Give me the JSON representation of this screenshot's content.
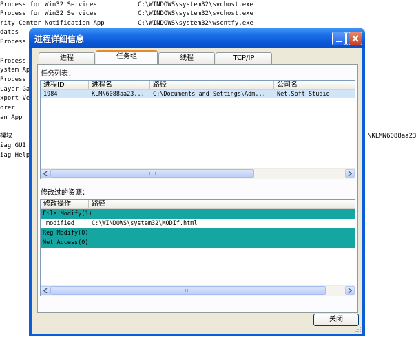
{
  "background": {
    "lines": [
      {
        "text": " Process for Win32 Services",
        "path": "C:\\WINDOWS\\system32\\svchost.exe"
      },
      {
        "text": " Process for Win32 Services",
        "path": "C:\\WINDOWS\\system32\\svchost.exe"
      },
      {
        "text": "rity Center Notification App",
        "path": "C:\\WINDOWS\\system32\\wscntfy.exe"
      },
      {
        "text": "dates",
        "path": ""
      },
      {
        "text": " Process",
        "path": ""
      },
      {
        "text": "",
        "path": ""
      },
      {
        "text": " Process",
        "path": ""
      },
      {
        "text": "ystem Ap",
        "path": ""
      },
      {
        "text": " Process",
        "path": ""
      },
      {
        "text": "Layer Ga",
        "path": ""
      },
      {
        "text": "xport Ve",
        "path": ""
      },
      {
        "text": "orer",
        "path": ""
      },
      {
        "text": " an App",
        "path": ""
      },
      {
        "text": "",
        "path": ""
      },
      {
        "text": "模块",
        "path": ""
      },
      {
        "text": "iag GUI I",
        "path": ""
      },
      {
        "text": "iag Help",
        "path": ""
      }
    ],
    "right_text": "\\KLMN6088aa23"
  },
  "dialog": {
    "title": "进程详细信息",
    "tabs": [
      "进程",
      "任务组",
      "线程",
      "TCP/IP"
    ],
    "active_tab": "任务组",
    "task_list_label": "任务列表：",
    "task_columns": [
      "进程ID",
      "进程名",
      "路径",
      "公司名"
    ],
    "task_rows": [
      {
        "pid": "1984",
        "name": "KLMN6088aa23...",
        "path": "C:\\Documents and Settings\\Adm...",
        "company": "Net.Soft Studio"
      }
    ],
    "resources_label": "修改过的资源：",
    "resource_columns": [
      "修改操作",
      "路径"
    ],
    "resource_groups": [
      {
        "title": "File Modify(1)",
        "items": [
          {
            "op": "modified",
            "path": "C:\\WINDOWS\\system32\\MODIf.html"
          }
        ]
      },
      {
        "title": "Reg Modify(0)",
        "items": []
      },
      {
        "title": "Net Access(0)",
        "items": []
      }
    ],
    "close_label": "关闭"
  },
  "colors": {
    "title_bar": "#0a58d6",
    "group_row": "#16a6a2",
    "selected_row": "#d0e6f8",
    "active_tab_accent": "#e68b2c"
  }
}
